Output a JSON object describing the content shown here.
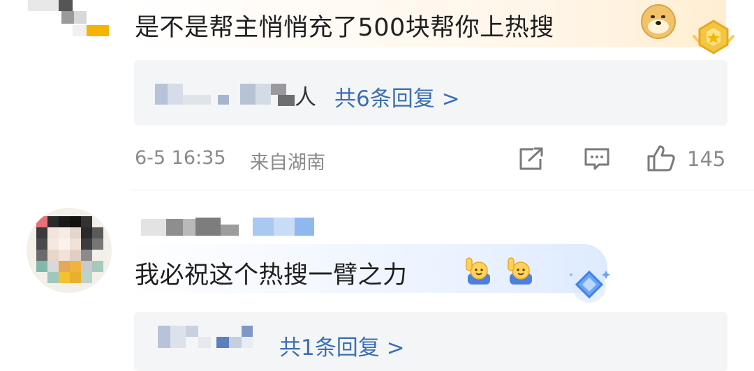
{
  "comment1": {
    "text": "是不是帮主悄悄充了500块帮你上热搜",
    "reply_suffix": "人",
    "reply_link": "共6条回复 >",
    "time": "6-5 16:35",
    "location": "来自湖南",
    "like_count": "145",
    "emoji_name": "doge-emoji",
    "badge_name": "gold-fan-badge-icon"
  },
  "comment2": {
    "text": "我必祝这个热搜一臂之力",
    "reply_link": "共1条回复 >",
    "emoji_names": [
      "raise-hand-emoji",
      "raise-hand-emoji"
    ],
    "badge_name": "blue-fan-badge-icon"
  },
  "colors": {
    "link": "#3b6fb3",
    "meta": "#8a8a8a",
    "text": "#1f1f1f",
    "reply_bg": "#f4f5f7"
  }
}
